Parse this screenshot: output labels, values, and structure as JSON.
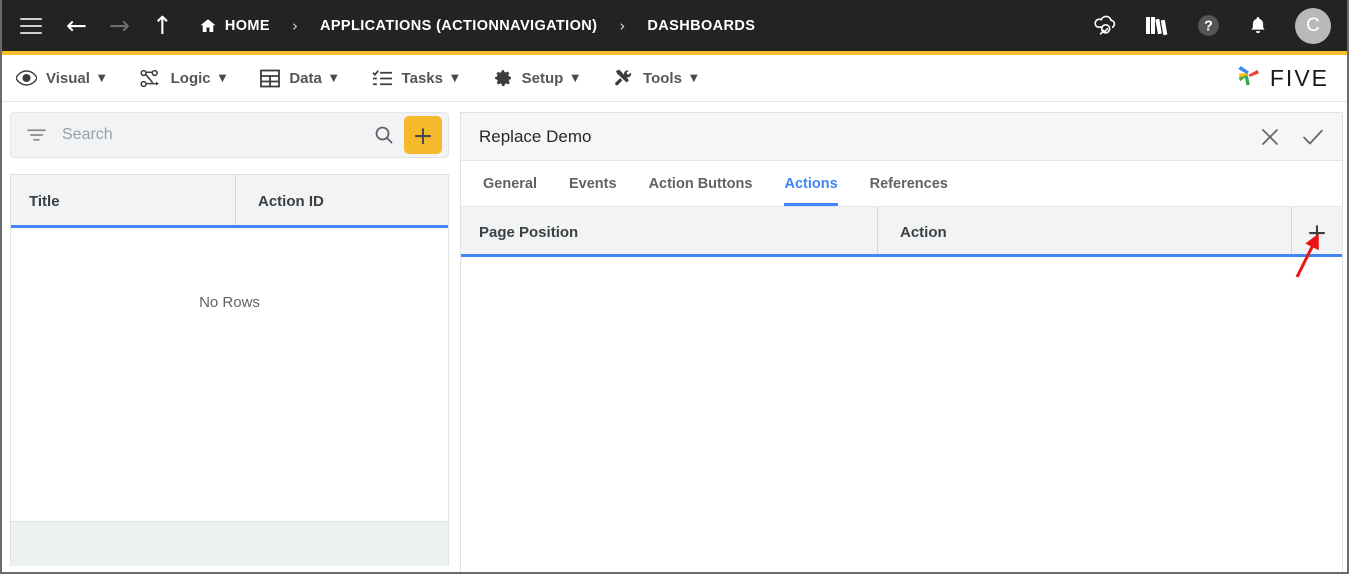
{
  "topbar": {
    "menu_icon": "hamburger-icon",
    "back_icon": "arrow-left-icon",
    "forward_icon": "arrow-right-icon",
    "up_icon": "arrow-up-icon",
    "breadcrumbs": [
      {
        "label": "HOME",
        "icon": "home-icon"
      },
      {
        "label": "APPLICATIONS (ACTIONNAVIGATION)",
        "icon": ""
      },
      {
        "label": "DASHBOARDS",
        "icon": ""
      }
    ],
    "separator": "›",
    "right_icons": [
      {
        "name": "cloud-search-icon"
      },
      {
        "name": "books-icon"
      },
      {
        "name": "help-icon"
      },
      {
        "name": "notifications-bell-icon"
      }
    ],
    "avatar_initial": "C",
    "background_color": "#232323",
    "accent_color": "#f8bd2a"
  },
  "menubar": {
    "items": [
      {
        "label": "Visual",
        "icon": "eye-icon",
        "caret": "▼"
      },
      {
        "label": "Logic",
        "icon": "logic-nodes-icon",
        "caret": "▼"
      },
      {
        "label": "Data",
        "icon": "table-grid-icon",
        "caret": "▼"
      },
      {
        "label": "Tasks",
        "icon": "checklist-icon",
        "caret": "▼"
      },
      {
        "label": "Setup",
        "icon": "gear-icon",
        "caret": "▼"
      },
      {
        "label": "Tools",
        "icon": "tools-icon",
        "caret": "▼"
      }
    ],
    "brand": {
      "text": "FIVE",
      "icon": "five-pinwheel-logo"
    }
  },
  "left_panel": {
    "search": {
      "placeholder": "Search",
      "value": "",
      "filter_icon": "filter-icon",
      "search_icon": "search-icon"
    },
    "add_button_label": "+",
    "add_button_color": "#f5ba2b",
    "grid": {
      "columns": [
        "Title",
        "Action ID"
      ],
      "rows": [],
      "empty_message": "No Rows"
    }
  },
  "right_panel": {
    "title": "Replace Demo",
    "header_actions": [
      {
        "name": "close-icon",
        "glyph": "✕"
      },
      {
        "name": "confirm-check-icon",
        "glyph": "✓"
      }
    ],
    "tabs": [
      {
        "label": "General",
        "active": false
      },
      {
        "label": "Events",
        "active": false
      },
      {
        "label": "Action Buttons",
        "active": false
      },
      {
        "label": "Actions",
        "active": true
      },
      {
        "label": "References",
        "active": false
      }
    ],
    "active_tab_color": "#4285f4",
    "grid": {
      "columns": [
        "Page Position",
        "Action"
      ],
      "rows": [],
      "add_row_button": "+"
    }
  },
  "annotation": {
    "arrow_color": "#ee1111",
    "points_to": "add-action-row-button"
  }
}
